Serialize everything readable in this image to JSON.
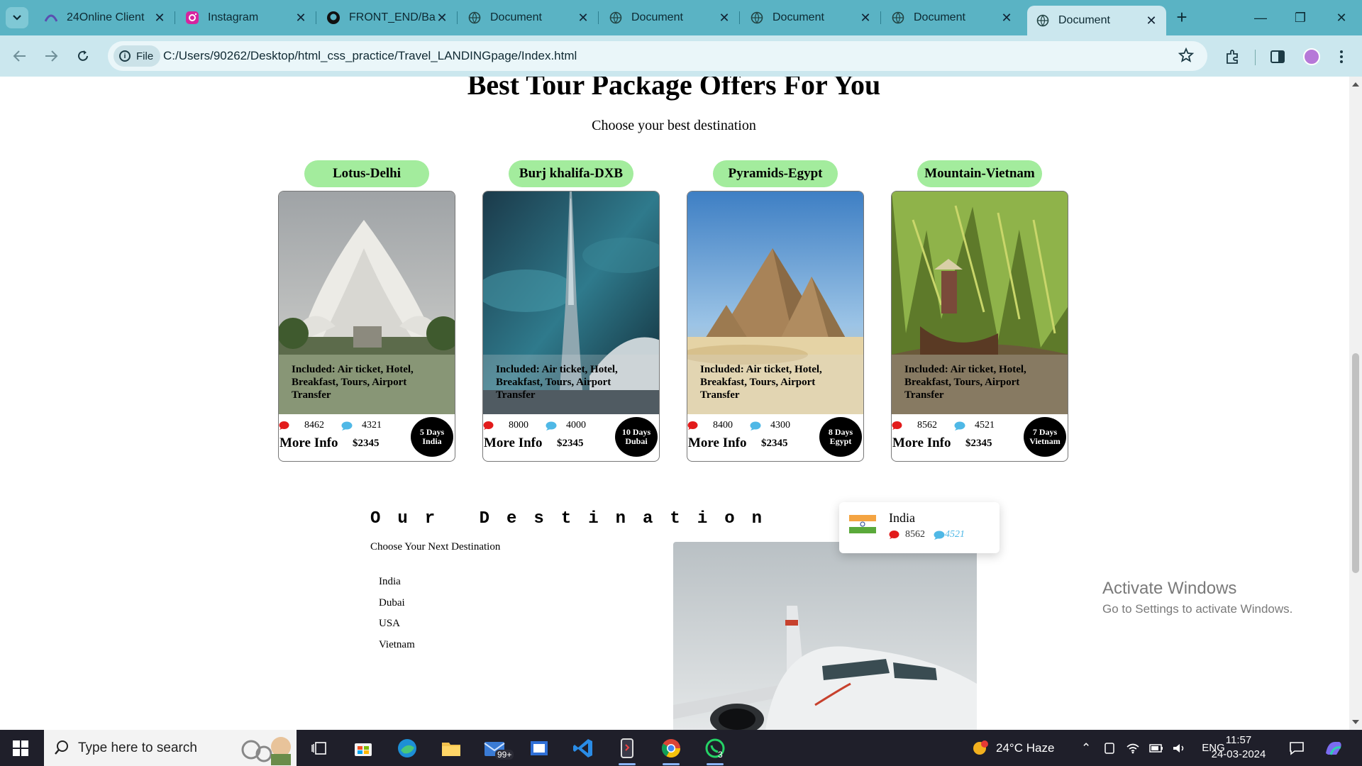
{
  "browser": {
    "tabs": [
      {
        "title": "24Online Client",
        "icon": "24online-icon"
      },
      {
        "title": "Instagram",
        "icon": "instagram-icon"
      },
      {
        "title": "FRONT_END/Ba",
        "icon": "github-icon"
      },
      {
        "title": "Document",
        "icon": "globe-icon"
      },
      {
        "title": "Document",
        "icon": "globe-icon"
      },
      {
        "title": "Document",
        "icon": "globe-icon"
      },
      {
        "title": "Document",
        "icon": "globe-icon"
      },
      {
        "title": "Document",
        "icon": "globe-icon",
        "active": true
      }
    ],
    "omnibox": {
      "chip_label": "File",
      "url": "C:/Users/90262/Desktop/html_css_practice/Travel_LANDINGpage/Index.html"
    }
  },
  "page": {
    "heading": "Best Tour Package Offers For You",
    "subheading": "Choose your best destination",
    "included_text": "Included: Air ticket, Hotel, Breakfast, Tours, Airport Transfer",
    "more_info": "More Info",
    "packages": [
      {
        "name": "Lotus-Delhi",
        "likes": "8462",
        "comments": "4321",
        "price": "$2345",
        "days": "5 Days",
        "place": "India"
      },
      {
        "name": "Burj khalifa-DXB",
        "likes": "8000",
        "comments": "4000",
        "price": "$2345",
        "days": "10 Days",
        "place": "Dubai"
      },
      {
        "name": "Pyramids-Egypt",
        "likes": "8400",
        "comments": "4300",
        "price": "$2345",
        "days": "8 Days",
        "place": "Egypt"
      },
      {
        "name": "Mountain-Vietnam",
        "likes": "8562",
        "comments": "4521",
        "price": "$2345",
        "days": "7 Days",
        "place": "Vietnam"
      }
    ],
    "destination": {
      "title": "Our Destination",
      "subtitle": "Choose Your Next Destination",
      "list": [
        "India",
        "Dubai",
        "USA",
        "Vietnam"
      ],
      "card": {
        "name": "India",
        "likes": "8562",
        "comments": "4521"
      }
    }
  },
  "watermark": {
    "line1": "Activate Windows",
    "line2": "Go to Settings to activate Windows."
  },
  "taskbar": {
    "search_placeholder": "Type here to search",
    "mail_badge": "99+",
    "whatsapp_badge": "3",
    "weather": "24°C  Haze",
    "language": "ENG",
    "time": "11:57",
    "date": "24-03-2024"
  },
  "colors": {
    "tabstrip": "#5ab3c4",
    "toolbar": "#cbe7ee",
    "pill": "#a3ec9d",
    "like_red": "#e21b1b",
    "comment_blue": "#4fb8e6"
  }
}
